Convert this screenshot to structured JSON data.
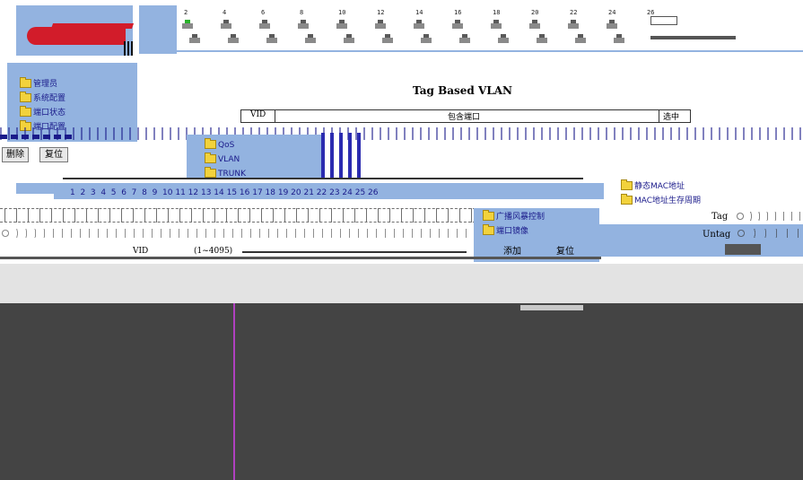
{
  "header": {
    "port_numbers_top": [
      "2",
      "4",
      "6",
      "8",
      "10",
      "12",
      "14",
      "16",
      "18",
      "20",
      "22",
      "24",
      "26"
    ]
  },
  "sidebar": {
    "items": [
      {
        "label": "管理员"
      },
      {
        "label": "系统配置"
      },
      {
        "label": "端口状态"
      },
      {
        "label": "端口配置"
      }
    ]
  },
  "submenu": {
    "items": [
      {
        "label": "QoS"
      },
      {
        "label": "VLAN"
      },
      {
        "label": "TRUNK"
      }
    ]
  },
  "right_menu": {
    "items": [
      {
        "label": "静态MAC地址"
      },
      {
        "label": "MAC地址生存周期"
      }
    ]
  },
  "mid_menu": {
    "items": [
      {
        "label": "广播风暴控制"
      },
      {
        "label": "端口镜像"
      }
    ]
  },
  "main": {
    "title": "Tag Based VLAN",
    "col_vid": "VID",
    "col_ports": "包含端口",
    "col_select": "选中",
    "delete_label": "删除",
    "reset_label": "复位",
    "port_index_row": "1  2  3  4  5  6  7  8  9  10 11 12 13 14 15 16 17 18 19 20 21 22 23 24 25 26",
    "tag_label": "Tag",
    "untag_label": "Untag",
    "vid_label": "VID",
    "vid_range": "(1~4095)",
    "add_label": "添加",
    "reset2_label": "复位"
  },
  "colors": {
    "menu_blue": "#93b3e0",
    "dark_panel": "#444444",
    "purple_line": "#b040c0"
  }
}
